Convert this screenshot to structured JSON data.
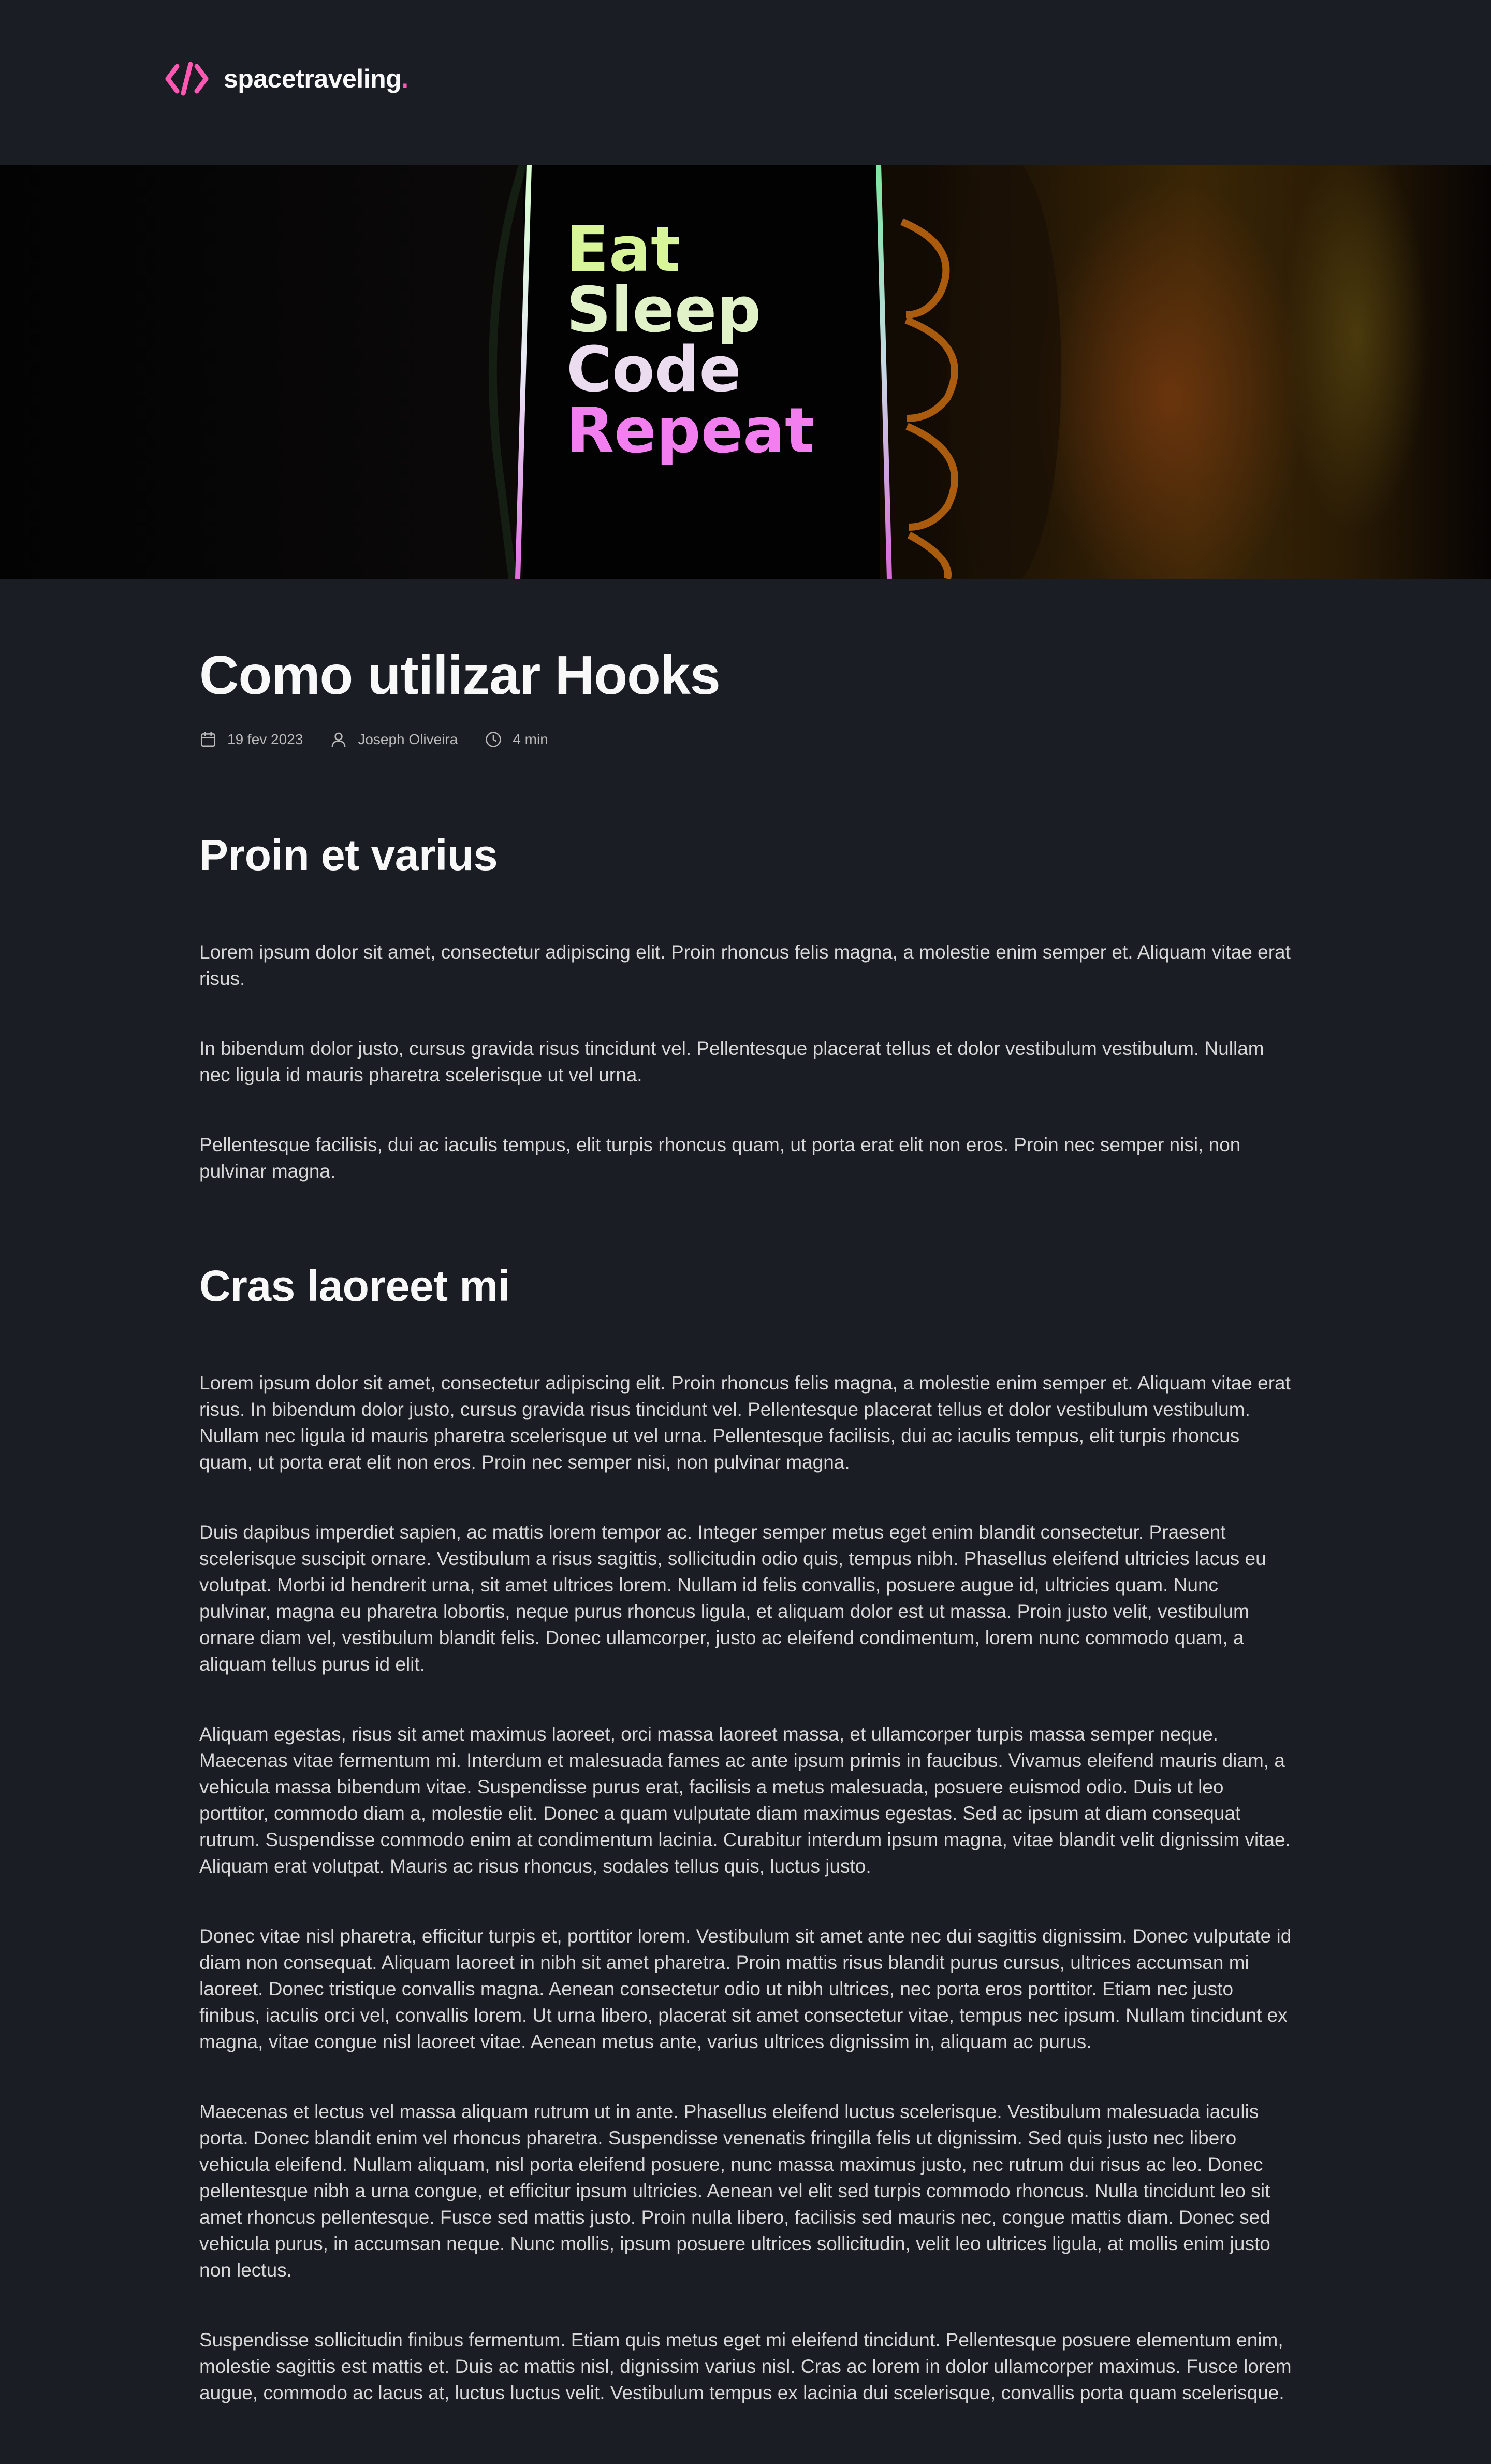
{
  "header": {
    "logo_text": "spacetraveling",
    "logo_dot": ".",
    "logo_icon": "code-brackets-icon",
    "accent_color": "#ff57b2"
  },
  "banner": {
    "lines": [
      "Eat",
      "Sleep",
      "Code",
      "Repeat"
    ]
  },
  "post": {
    "title": "Como utilizar Hooks",
    "date": "19 fev 2023",
    "author": "Joseph Oliveira",
    "reading_time": "4 min",
    "date_icon": "calendar-icon",
    "author_icon": "user-icon",
    "time_icon": "clock-icon"
  },
  "content": [
    {
      "heading": "Proin et varius",
      "paragraphs": [
        "Lorem ipsum dolor sit amet, consectetur adipiscing elit. Proin rhoncus felis magna, a molestie enim semper et. Aliquam vitae erat risus.",
        "In bibendum dolor justo, cursus gravida risus tincidunt vel. Pellentesque placerat tellus et dolor vestibulum vestibulum. Nullam nec ligula id mauris pharetra scelerisque ut vel urna.",
        "Pellentesque facilisis, dui ac iaculis tempus, elit turpis rhoncus quam, ut porta erat elit non eros. Proin nec semper nisi, non pulvinar magna."
      ]
    },
    {
      "heading": "Cras laoreet mi",
      "paragraphs": [
        "Lorem ipsum dolor sit amet, consectetur adipiscing elit. Proin rhoncus felis magna, a molestie enim semper et. Aliquam vitae erat risus. In bibendum dolor justo, cursus gravida risus tincidunt vel. Pellentesque placerat tellus et dolor vestibulum vestibulum. Nullam nec ligula id mauris pharetra scelerisque ut vel urna. Pellentesque facilisis, dui ac iaculis tempus, elit turpis rhoncus quam, ut porta erat elit non eros. Proin nec semper nisi, non pulvinar magna.",
        "Duis dapibus imperdiet sapien, ac mattis lorem tempor ac. Integer semper metus eget enim blandit consectetur. Praesent scelerisque suscipit ornare. Vestibulum a risus sagittis, sollicitudin odio quis, tempus nibh. Phasellus eleifend ultricies lacus eu volutpat. Morbi id hendrerit urna, sit amet ultrices lorem. Nullam id felis convallis, posuere augue id, ultricies quam. Nunc pulvinar, magna eu pharetra lobortis, neque purus rhoncus ligula, et aliquam dolor est ut massa. Proin justo velit, vestibulum ornare diam vel, vestibulum blandit felis. Donec ullamcorper, justo ac eleifend condimentum, lorem nunc commodo quam, a aliquam tellus purus id elit.",
        "Aliquam egestas, risus sit amet maximus laoreet, orci massa laoreet massa, et ullamcorper turpis massa semper neque. Maecenas vitae fermentum mi. Interdum et malesuada fames ac ante ipsum primis in faucibus. Vivamus eleifend mauris diam, a vehicula massa bibendum vitae. Suspendisse purus erat, facilisis a metus malesuada, posuere euismod odio. Duis ut leo porttitor, commodo diam a, molestie elit. Donec a quam vulputate diam maximus egestas. Sed ac ipsum at diam consequat rutrum. Suspendisse commodo enim at condimentum lacinia. Curabitur interdum ipsum magna, vitae blandit velit dignissim vitae. Aliquam erat volutpat. Mauris ac risus rhoncus, sodales tellus quis, luctus justo.",
        "Donec vitae nisl pharetra, efficitur turpis et, porttitor lorem. Vestibulum sit amet ante nec dui sagittis dignissim. Donec vulputate id diam non consequat. Aliquam laoreet in nibh sit amet pharetra. Proin mattis risus blandit purus cursus, ultrices accumsan mi laoreet. Donec tristique convallis magna. Aenean consectetur odio ut nibh ultrices, nec porta eros porttitor. Etiam nec justo finibus, iaculis orci vel, convallis lorem. Ut urna libero, placerat sit amet consectetur vitae, tempus nec ipsum. Nullam tincidunt ex magna, vitae congue nisl laoreet vitae. Aenean metus ante, varius ultrices dignissim in, aliquam ac purus.",
        "Maecenas et lectus vel massa aliquam rutrum ut in ante. Phasellus eleifend luctus scelerisque. Vestibulum malesuada iaculis porta. Donec blandit enim vel rhoncus pharetra. Suspendisse venenatis fringilla felis ut dignissim. Sed quis justo nec libero vehicula eleifend. Nullam aliquam, nisl porta eleifend posuere, nunc massa maximus justo, nec rutrum dui risus ac leo. Donec pellentesque nibh a urna congue, et efficitur ipsum ultricies. Aenean vel elit sed turpis commodo rhoncus. Nulla tincidunt leo sit amet rhoncus pellentesque. Fusce sed mattis justo. Proin nulla libero, facilisis sed mauris nec, congue mattis diam. Donec sed vehicula purus, in accumsan neque. Nunc mollis, ipsum posuere ultrices sollicitudin, velit leo ultrices ligula, at mollis enim justo non lectus.",
        "Suspendisse sollicitudin finibus fermentum. Etiam quis metus eget mi eleifend tincidunt. Pellentesque posuere elementum enim, molestie sagittis est mattis et. Duis ac mattis nisl, dignissim varius nisl. Cras ac lorem in dolor ullamcorper maximus. Fusce lorem augue, commodo ac lacus at, luctus luctus velit. Vestibulum tempus ex lacinia dui scelerisque, convallis porta quam scelerisque."
      ]
    }
  ]
}
